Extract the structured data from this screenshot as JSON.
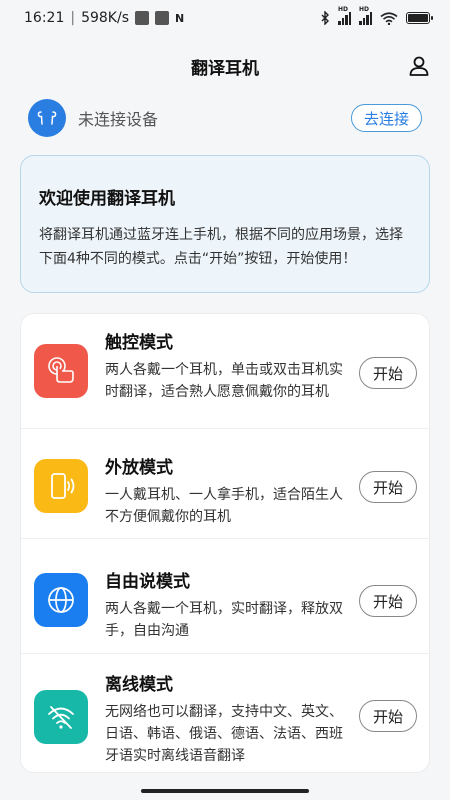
{
  "status_bar": {
    "time": "16:21",
    "speed": "598K/s",
    "sim1_label": "HD",
    "sim2_label": "HD",
    "battery_icon": "battery-icon"
  },
  "header": {
    "title": "翻译耳机",
    "profile_icon": "user-icon"
  },
  "device": {
    "status": "未连接设备",
    "connect_label": "去连接",
    "accent": "#2a7de1"
  },
  "welcome": {
    "title": "欢迎使用翻译耳机",
    "text": "将翻译耳机通过蓝牙连上手机，根据不同的应用场景，选择下面4种不同的模式。点击“开始”按钮，开始使用！"
  },
  "modes": [
    {
      "title": "触控模式",
      "desc": "两人各戴一个耳机，单击或双击耳机实时翻译，适合熟人愿意佩戴你的耳机",
      "button": "开始",
      "icon": "touch-icon",
      "color": "#f0584a"
    },
    {
      "title": "外放模式",
      "desc": "一人戴耳机、一人拿手机，适合陌生人不方便佩戴你的耳机",
      "button": "开始",
      "icon": "phone-speaker-icon",
      "color": "#fbb915"
    },
    {
      "title": "自由说模式",
      "desc": "两人各戴一个耳机，实时翻译，释放双手，自由沟通",
      "button": "开始",
      "icon": "globe-icon",
      "color": "#1a7ef0"
    },
    {
      "title": "离线模式",
      "desc": "无网络也可以翻译，支持中文、英文、日语、韩语、俄语、德语、法语、西班牙语实时离线语音翻译",
      "button": "开始",
      "icon": "wifi-off-icon",
      "color": "#17b8a8"
    }
  ]
}
